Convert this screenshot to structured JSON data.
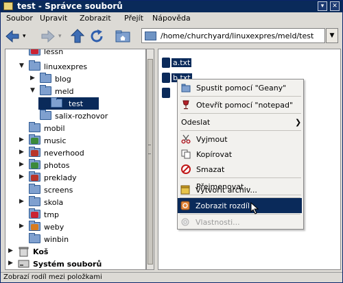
{
  "window": {
    "title": "test - Správce souborů",
    "controls": [
      "▾",
      "✕"
    ]
  },
  "menu": [
    "Soubor",
    "Upravit",
    "Zobrazit",
    "Přejít",
    "Nápověda"
  ],
  "address": {
    "path": "/home/churchyard/linuxexpres/meld/test"
  },
  "tree": {
    "items": [
      {
        "label": "lessn"
      },
      {
        "label": "linuxexpres",
        "arrow": "▼"
      },
      {
        "label": "blog",
        "arrow": "▶"
      },
      {
        "label": "meld",
        "arrow": "▼"
      },
      {
        "label": "test"
      },
      {
        "label": "salix-rozhovor"
      },
      {
        "label": "mobil"
      },
      {
        "label": "music",
        "arrow": "▶"
      },
      {
        "label": "neverhood",
        "arrow": "▶"
      },
      {
        "label": "photos",
        "arrow": "▶"
      },
      {
        "label": "preklady",
        "arrow": "▶"
      },
      {
        "label": "screens"
      },
      {
        "label": "skola",
        "arrow": "▶"
      },
      {
        "label": "tmp"
      },
      {
        "label": "weby",
        "arrow": "▶"
      },
      {
        "label": "winbin"
      },
      {
        "label": "Koš",
        "arrow": "▶"
      },
      {
        "label": "Systém souborů",
        "arrow": "▶"
      }
    ]
  },
  "files": [
    {
      "name": "a.txt"
    },
    {
      "name": "b.txt"
    }
  ],
  "context_menu": {
    "items": [
      {
        "label": "Spustit pomocí \"Geany\""
      },
      {
        "label": "Otevřít pomocí \"notepad\""
      },
      {
        "label": "Odeslat",
        "submenu": "❯"
      },
      {
        "label": "Vyjmout"
      },
      {
        "label": "Kopírovat"
      },
      {
        "label": "Smazat"
      },
      {
        "label": "Přejmenovat..."
      },
      {
        "label": "Vytvořit archiv..."
      },
      {
        "label": "Zobrazit rozdíl"
      },
      {
        "label": "Vlastnosti..."
      }
    ]
  },
  "status": "Zobrazí rodíl mezi položkami",
  "colors": {
    "selection": "#0a2a5a",
    "folder": "#7fa0cf",
    "titlebar": "#0a2a5a"
  }
}
